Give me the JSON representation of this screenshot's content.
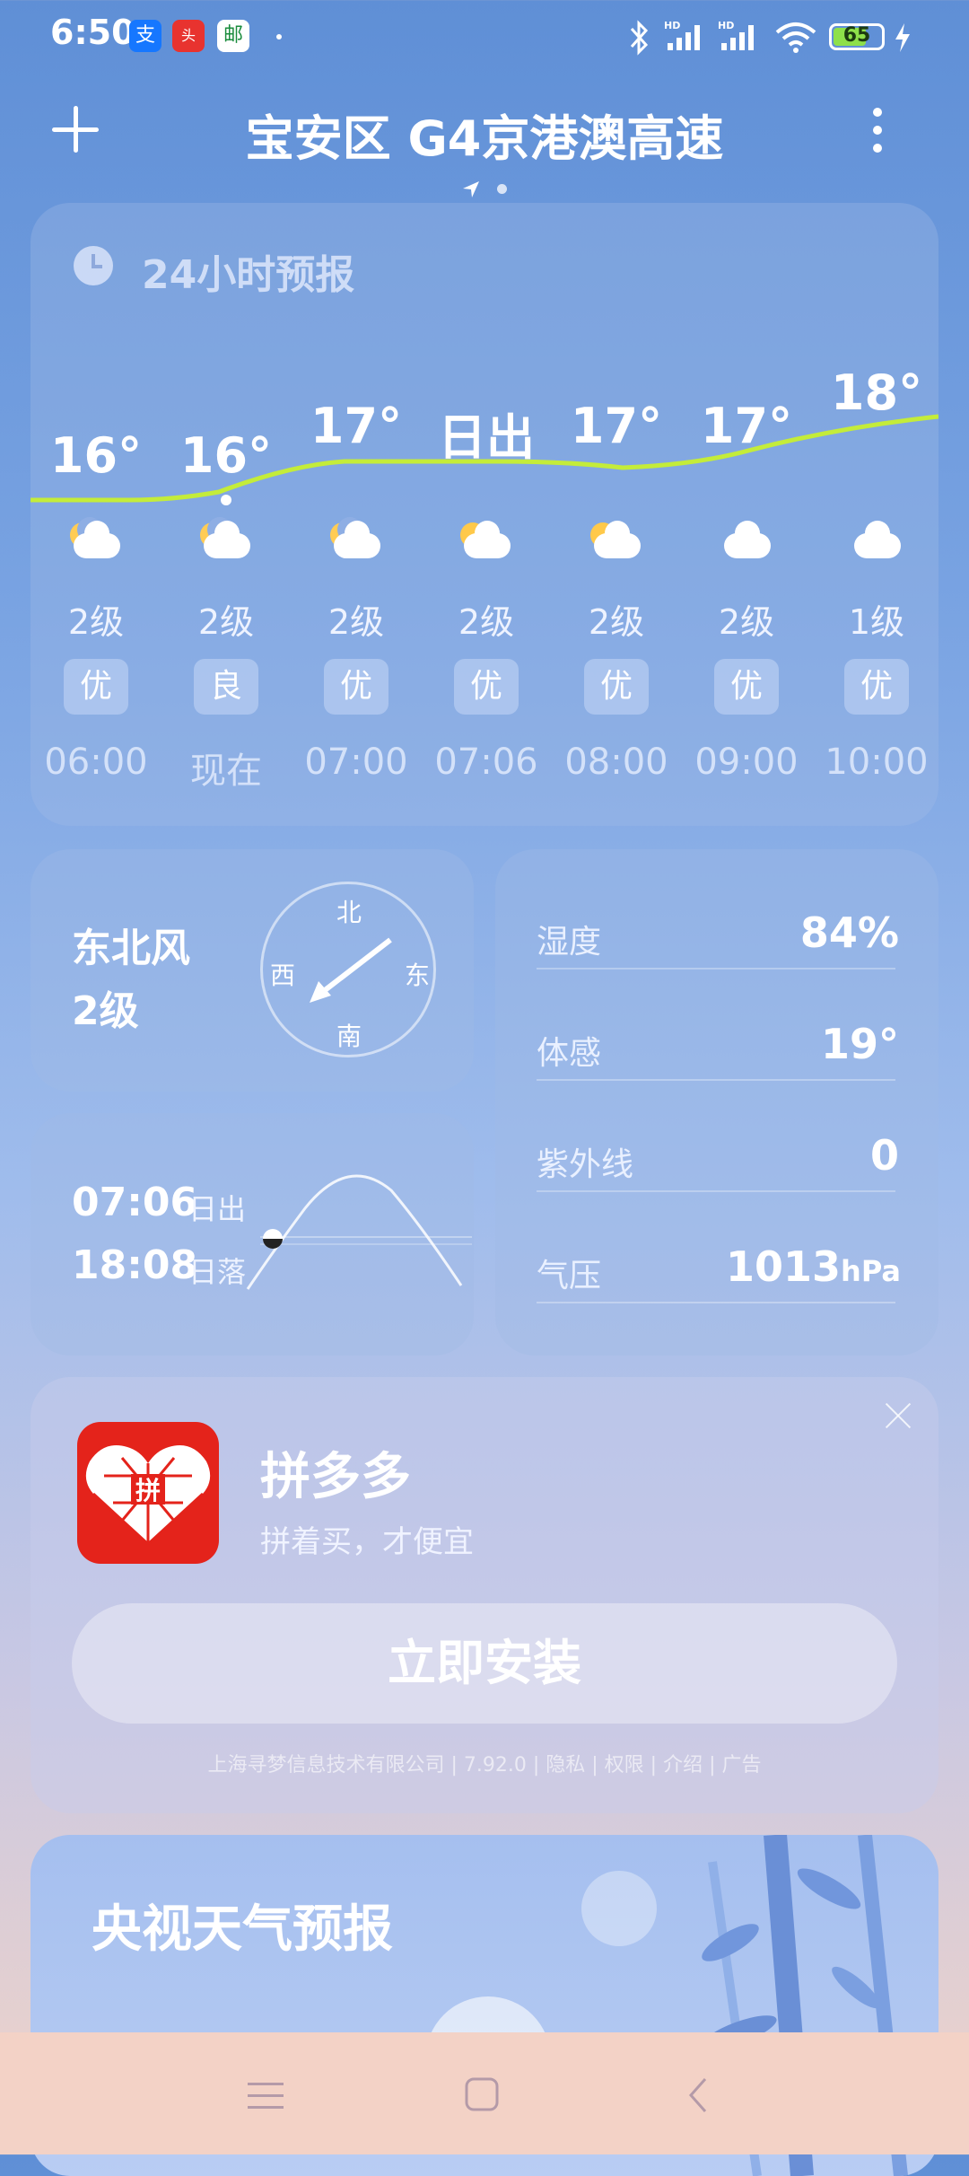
{
  "status_bar": {
    "time": "6:50",
    "apps": [
      "alipay-icon",
      "toutiao-icon",
      "post-icon"
    ],
    "network": "HD",
    "battery": "65"
  },
  "header": {
    "title": "宝安区 G4京港澳高速"
  },
  "hourly": {
    "title": "24小时预报",
    "temps": [
      "16°",
      "16°",
      "17°",
      "日出",
      "17°",
      "17°",
      "18°"
    ],
    "wind": [
      "2级",
      "2级",
      "2级",
      "2级",
      "2级",
      "2级",
      "1级"
    ],
    "aqi": [
      "优",
      "良",
      "优",
      "优",
      "优",
      "优",
      "优"
    ],
    "times": [
      "06:00",
      "现在",
      "07:00",
      "07:06",
      "08:00",
      "09:00",
      "10:00"
    ]
  },
  "wind": {
    "direction": "东北风",
    "level": "2级",
    "compass": {
      "n": "北",
      "s": "南",
      "e": "东",
      "w": "西"
    }
  },
  "sun": {
    "sunrise_time": "07:06",
    "sunrise_label": "日出",
    "sunset_time": "18:08",
    "sunset_label": "日落"
  },
  "details": {
    "humidity_label": "湿度",
    "humidity_value": "84%",
    "feels_label": "体感",
    "feels_value": "19°",
    "uv_label": "紫外线",
    "uv_value": "0",
    "pressure_label": "气压",
    "pressure_value": "1013",
    "pressure_unit": "hPa"
  },
  "ad": {
    "app_name": "拼多多",
    "slogan": "拼着买，才便宜",
    "install_label": "立即安装",
    "icon_text": "拼",
    "footer": "上海寻梦信息技术有限公司 | 7.92.0 | 隐私 | 权限 | 介绍 | 广告"
  },
  "cctv": {
    "title": "央视天气预报"
  },
  "colors": {
    "temp_curve": "#c4ec3a",
    "ad_icon_red": "#e4231b"
  }
}
